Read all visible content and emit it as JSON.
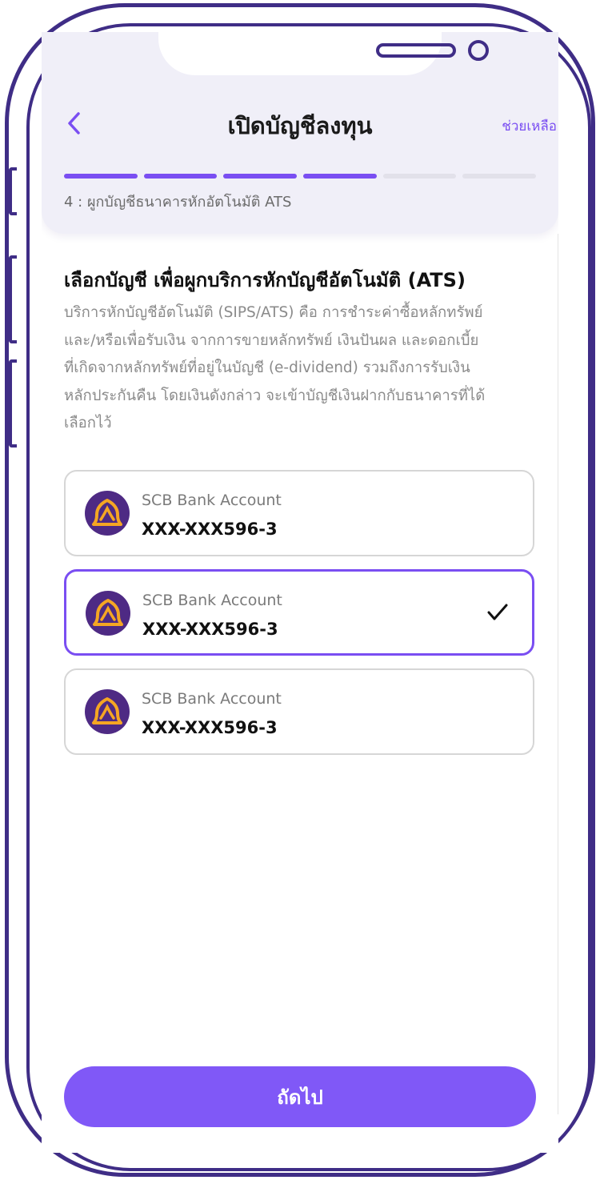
{
  "header": {
    "back_icon": "chevron-left-icon",
    "title": "เปิดบัญชีลงทุน",
    "help_label": "ช่วยเหลือ",
    "progress": {
      "total_steps": 6,
      "completed_steps": 4
    },
    "step_label": "4 : ผูกบัญชีธนาคารหักอัตโนมัติ ATS"
  },
  "main": {
    "section_title": "เลือกบัญชี เพื่อผูกบริการหักบัญชีอัตโนมัติ (ATS)",
    "description_lines": [
      "บริการหักบัญชีอัตโนมัติ (SIPS/ATS) คือ การชำระค่าซื้อหลักทรัพย์",
      "และ/หรือเพื่อรับเงิน จากการขายหลักทรัพย์ เงินปันผล และดอกเบี้ย",
      "ที่เกิดจากหลักทรัพย์ที่อยู่ในบัญชี (e-dividend) รวมถึงการรับเงิน",
      "หลักประกันคืน โดยเงินดังกล่าว จะเข้าบัญชีเงินฝากกับธนาคารที่ได้",
      "เลือกไว้"
    ],
    "accounts": [
      {
        "bank_name": "SCB Bank Account",
        "account_number": "XXX-XXX596-3",
        "selected": false
      },
      {
        "bank_name": "SCB Bank Account",
        "account_number": "XXX-XXX596-3",
        "selected": true
      },
      {
        "bank_name": "SCB Bank Account",
        "account_number": "XXX-XXX596-3",
        "selected": false
      }
    ]
  },
  "footer": {
    "next_label": "ถัดไป"
  },
  "colors": {
    "accent": "#7a4ef2",
    "button": "#8058f7",
    "frame": "#3f2d86",
    "header_bg": "#f0eff8",
    "bank_logo_bg": "#4e2a84",
    "bank_logo_fg": "#f5a623"
  }
}
